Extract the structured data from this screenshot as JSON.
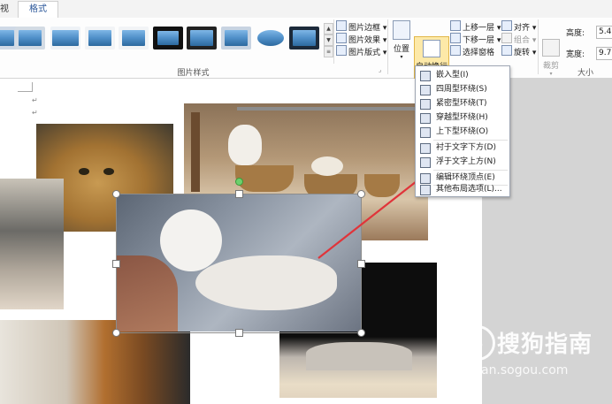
{
  "tabs": {
    "view_partial": "视图",
    "format": "格式"
  },
  "picture_styles": {
    "group_label": "图片样式"
  },
  "picture_commands": {
    "border": "图片边框",
    "effects": "图片效果",
    "layout": "图片版式"
  },
  "arrange": {
    "position": "位置",
    "wrap_text": "自动换行",
    "bring_forward": "上移一层",
    "send_backward": "下移一层",
    "selection_pane": "选择窗格",
    "align": "对齐",
    "group": "组合",
    "rotate": "旋转"
  },
  "size": {
    "crop": "裁剪",
    "height_label": "高度:",
    "height_value": "5.49",
    "width_label": "宽度:",
    "width_value": "9.77",
    "group_label": "大小"
  },
  "wrap_menu": {
    "items": [
      {
        "label": "嵌入型(I)"
      },
      {
        "label": "四周型环绕(S)"
      },
      {
        "label": "紧密型环绕(T)"
      },
      {
        "label": "穿越型环绕(H)"
      },
      {
        "label": "上下型环绕(O)"
      },
      {
        "label": "衬于文字下方(D)"
      },
      {
        "label": "浮于文字上方(N)"
      },
      {
        "label": "编辑环绕顶点(E)"
      },
      {
        "label": "其他布局选项(L)..."
      }
    ]
  },
  "paragraph_marks": [
    "↵",
    "↵"
  ],
  "watermark": {
    "logo": "S",
    "text": "搜狗指南",
    "url": "zhinan.sogou.com"
  },
  "colors": {
    "accent": "#2b579a",
    "highlight": "#fde9a8",
    "arrow": "#e0343a"
  }
}
